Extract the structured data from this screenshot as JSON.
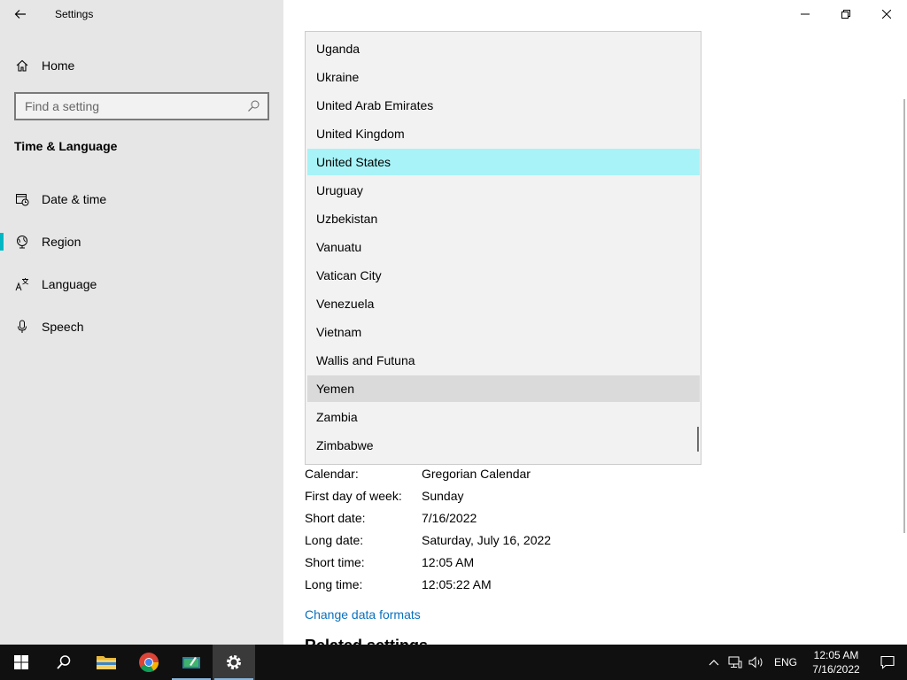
{
  "window": {
    "title": "Settings"
  },
  "sidebar": {
    "home_label": "Home",
    "search_placeholder": "Find a setting",
    "section_title": "Time & Language",
    "items": [
      {
        "label": "Date & time",
        "icon": "calendar-clock-icon"
      },
      {
        "label": "Region",
        "icon": "globe-icon",
        "selected": true
      },
      {
        "label": "Language",
        "icon": "language-icon"
      },
      {
        "label": "Speech",
        "icon": "microphone-icon"
      }
    ]
  },
  "dropdown": {
    "options": [
      "Uganda",
      "Ukraine",
      "United Arab Emirates",
      "United Kingdom",
      "United States",
      "Uruguay",
      "Uzbekistan",
      "Vanuatu",
      "Vatican City",
      "Venezuela",
      "Vietnam",
      "Wallis and Futuna",
      "Yemen",
      "Zambia",
      "Zimbabwe"
    ],
    "selected": "United States",
    "hovered": "Yemen"
  },
  "formats": {
    "rows": [
      {
        "label": "Calendar:",
        "value": "Gregorian Calendar"
      },
      {
        "label": "First day of week:",
        "value": "Sunday"
      },
      {
        "label": "Short date:",
        "value": "7/16/2022"
      },
      {
        "label": "Long date:",
        "value": "Saturday, July 16, 2022"
      },
      {
        "label": "Short time:",
        "value": "12:05 AM"
      },
      {
        "label": "Long time:",
        "value": "12:05:22 AM"
      }
    ],
    "change_link": "Change data formats",
    "related_heading": "Related settings"
  },
  "taskbar": {
    "language": "ENG",
    "time": "12:05 AM",
    "date": "7/16/2022"
  },
  "colors": {
    "accent": "#00b7c3",
    "selected_bg": "#a7f3f7",
    "link": "#0a70bd",
    "sidebar_bg": "#e6e6e6",
    "taskbar_bg": "#101010"
  }
}
